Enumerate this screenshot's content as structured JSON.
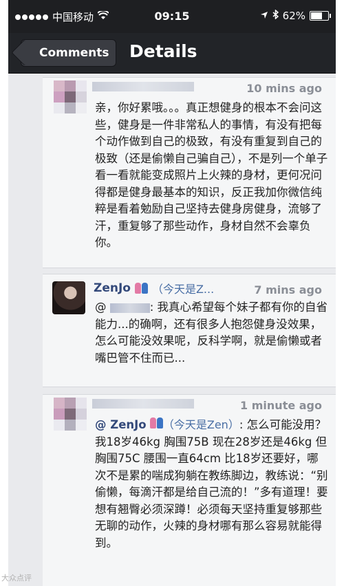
{
  "status_bar": {
    "carrier": "中国移动",
    "time": "09:15",
    "battery": "62%"
  },
  "nav": {
    "back_label": "Comments",
    "title": "Details"
  },
  "comments": [
    {
      "time": "10 mins ago",
      "text": "亲，你好累哦。。。真正想健身的根本不会问这些，健身是一件非常私人的事情，有没有把每个动作做到自己的极致，有没有重复到自己的极致（还是偷懒自己骗自己），不是列一个单子看一看就能变成照片上火辣的身材，更何况问得都是健身最基本的知识，反正我加你微信纯粹是看着勉励自己坚持去健身房健身，流够了汗，重复够了那些动作，身材自然不会辜负你。"
    },
    {
      "name": "ZenJo",
      "name_extra": "（今天是Z...",
      "time": "7 mins ago",
      "at": "@",
      "text": ": 我真心希望每个妹子都有你的自省能力...的确啊，还有很多人抱怨健身没效果，怎么可能没效果呢，反科学啊，就是偷懒或者嘴巴管不住而已..."
    },
    {
      "time": "1 minute ago",
      "at": "@ ZenJo",
      "name_extra": "（今天是Zen）",
      "text": ": 怎么可能没用？我18岁46kg 胸围75B 现在28岁还是46kg 但胸围75C 腰围一直64cm 比18岁还要好，哪次不是累的喘成狗躺在教练脚边，教练说：“别偷懒，每滴汗都是给自己流的！”多有道理！要想有翘臀必须深蹲！必须每天坚持重复够那些无聊的动作，火辣的身材哪有那么容易就能得到。"
    }
  ],
  "watermark": "大众点评"
}
